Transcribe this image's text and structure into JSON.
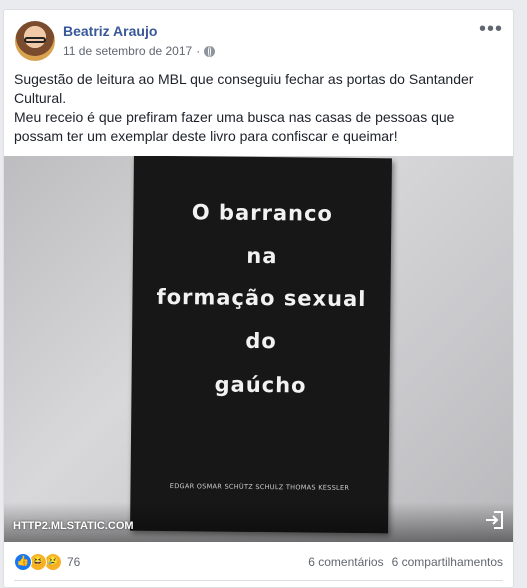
{
  "post": {
    "author": "Beatriz Araujo",
    "date": "11 de setembro de 2017",
    "more_icon": "more-horizontal-icon",
    "paragraphs": [
      "Sugestão de leitura ao MBL que conseguiu fechar as portas do Santander Cultural.",
      "Meu receio é que prefiram fazer uma busca nas casas de pessoas que possam ter um exemplar deste livro para confiscar e queimar!"
    ]
  },
  "photo": {
    "book_title_lines": [
      "O barranco",
      "na",
      "formação sexual",
      "do",
      "gaúcho"
    ],
    "book_authors": "EDGAR OSMAR SCHÜTZ SCHULZ  THOMAS KESSLER",
    "source": "HTTP2.MLSTATIC.COM"
  },
  "footer": {
    "reaction_count": "76",
    "comments": "6 comentários",
    "shares": "6 compartilhamentos"
  },
  "colors": {
    "author_link": "#385898",
    "like_blue": "#1877f2",
    "reaction_yellow": "#f7b125"
  }
}
